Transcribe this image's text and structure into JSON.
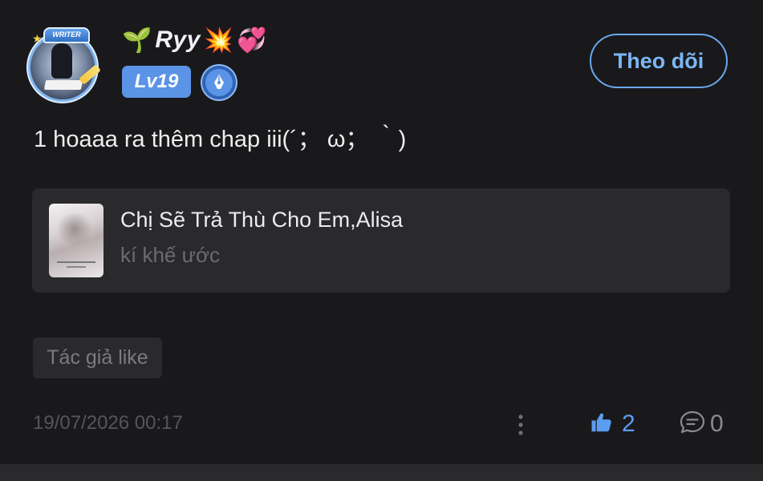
{
  "post": {
    "author": {
      "name": "Ryy",
      "name_prefix_emoji": "🌱",
      "name_suffix_emojis": [
        "💥",
        "💞"
      ],
      "level": "Lv19",
      "avatar_frame_label": "WRITER",
      "avatar_icon": "avatar-writer-frame",
      "badge_icon": "pen-nib-icon"
    },
    "follow_label": "Theo dõi",
    "text": "1 hoaaa ra thêm chap iii(´； ω； ｀)",
    "book": {
      "title": "Chị Sẽ Trả Thù Cho Em,Alisa",
      "author": "kí khế ước",
      "cover_icon": "book-cover"
    },
    "author_liked_tag": "Tác giả like",
    "timestamp": "19/07/2026 00:17",
    "likes": "2",
    "comments": "0",
    "icons": {
      "more": "more-vertical-icon",
      "like": "thumbs-up-icon",
      "comment": "comment-bubble-icon"
    },
    "colors": {
      "background": "#19191b",
      "card": "#2a2a2c",
      "accent": "#5b9df0",
      "badge": "#5b93e6",
      "muted": "#6b6b70"
    }
  }
}
